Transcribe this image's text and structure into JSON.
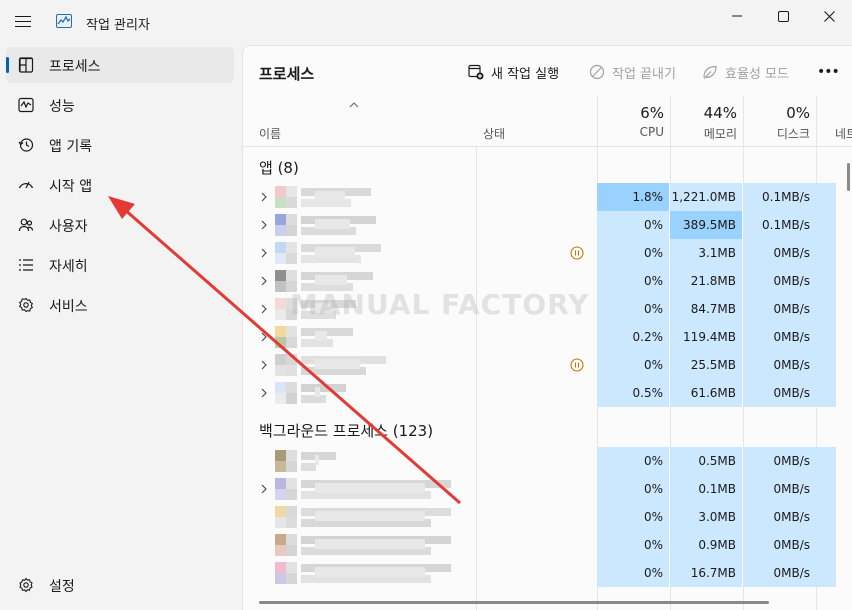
{
  "window": {
    "title": "작업 관리자"
  },
  "sidebar": {
    "items": [
      {
        "label": "프로세스",
        "icon": "processes-icon",
        "active": true
      },
      {
        "label": "성능",
        "icon": "performance-icon",
        "active": false
      },
      {
        "label": "앱 기록",
        "icon": "app-history-icon",
        "active": false
      },
      {
        "label": "시작 앱",
        "icon": "startup-apps-icon",
        "active": false
      },
      {
        "label": "사용자",
        "icon": "users-icon",
        "active": false
      },
      {
        "label": "자세히",
        "icon": "details-icon",
        "active": false
      },
      {
        "label": "서비스",
        "icon": "services-icon",
        "active": false
      }
    ],
    "settings": "설정"
  },
  "main": {
    "title": "프로세스",
    "actions": {
      "run_new_task": "새 작업 실행",
      "end_task": "작업 끝내기",
      "efficiency_mode": "효율성 모드",
      "more": "•••"
    },
    "columns": {
      "name": "이름",
      "status": "상태",
      "cpu": {
        "pct": "6%",
        "label": "CPU"
      },
      "memory": {
        "pct": "44%",
        "label": "메모리"
      },
      "disk": {
        "pct": "0%",
        "label": "디스크"
      },
      "network": {
        "label": "네트"
      }
    },
    "apps_header": "앱 (8)",
    "background_header": "백그라운드 프로세스 (123)",
    "apps": [
      {
        "cpu": "1.8%",
        "mem": "1,221.0MB",
        "disk": "0.1MB/s",
        "paused": false
      },
      {
        "cpu": "0%",
        "mem": "389.5MB",
        "disk": "0.1MB/s",
        "paused": false
      },
      {
        "cpu": "0%",
        "mem": "3.1MB",
        "disk": "0MB/s",
        "paused": true
      },
      {
        "cpu": "0%",
        "mem": "21.8MB",
        "disk": "0MB/s",
        "paused": false
      },
      {
        "cpu": "0%",
        "mem": "84.7MB",
        "disk": "0MB/s",
        "paused": false
      },
      {
        "cpu": "0.2%",
        "mem": "119.4MB",
        "disk": "0MB/s",
        "paused": false
      },
      {
        "cpu": "0%",
        "mem": "25.5MB",
        "disk": "0MB/s",
        "paused": true
      },
      {
        "cpu": "0.5%",
        "mem": "61.6MB",
        "disk": "0MB/s",
        "paused": false
      }
    ],
    "background": [
      {
        "cpu": "0%",
        "mem": "0.5MB",
        "disk": "0MB/s"
      },
      {
        "cpu": "0%",
        "mem": "0.1MB",
        "disk": "0MB/s"
      },
      {
        "cpu": "0%",
        "mem": "3.0MB",
        "disk": "0MB/s"
      },
      {
        "cpu": "0%",
        "mem": "0.9MB",
        "disk": "0MB/s"
      },
      {
        "cpu": "0%",
        "mem": "16.7MB",
        "disk": "0MB/s"
      }
    ]
  },
  "watermark": "MANUAL FACTORY",
  "colors": {
    "heat_light": "#cce8ff",
    "heat_mid": "#99d2ff",
    "accent": "#005fb8",
    "arrow": "#e53935",
    "pause": "#c07a00"
  }
}
